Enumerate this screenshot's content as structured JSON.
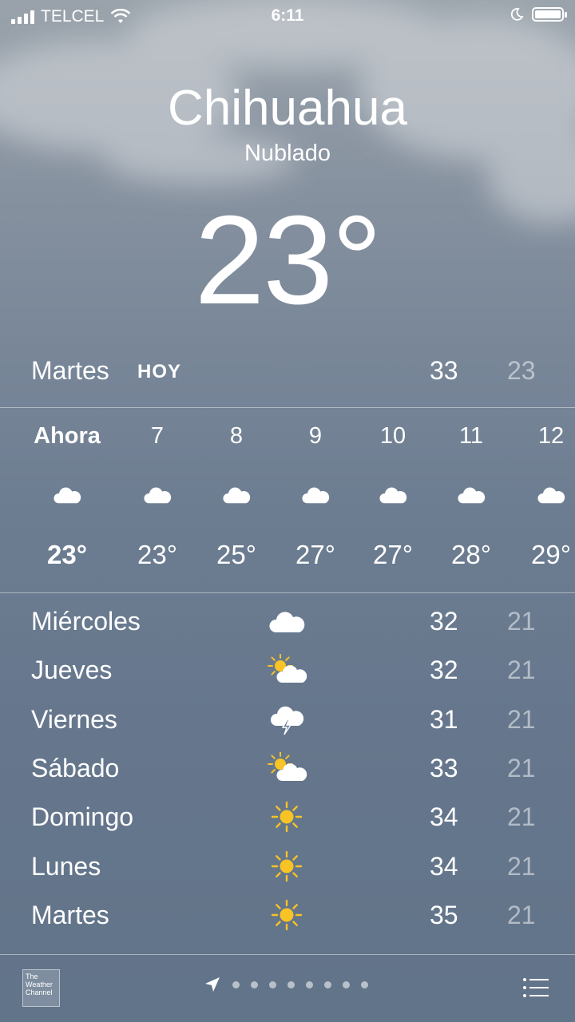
{
  "status_bar": {
    "carrier": "TELCEL",
    "time": "6:11"
  },
  "location": {
    "city": "Chihuahua",
    "condition": "Nublado",
    "temperature": "23°"
  },
  "today": {
    "day": "Martes",
    "tag": "HOY",
    "high": "33",
    "low": "23"
  },
  "hourly": [
    {
      "hour": "Ahora",
      "icon": "cloud-icon",
      "temp": "23°"
    },
    {
      "hour": "7",
      "icon": "cloud-icon",
      "temp": "23°"
    },
    {
      "hour": "8",
      "icon": "cloud-icon",
      "temp": "25°"
    },
    {
      "hour": "9",
      "icon": "cloud-icon",
      "temp": "27°"
    },
    {
      "hour": "10",
      "icon": "cloud-icon",
      "temp": "27°"
    },
    {
      "hour": "11",
      "icon": "cloud-icon",
      "temp": "28°"
    },
    {
      "hour": "12",
      "icon": "cloud-icon",
      "temp": "29°"
    }
  ],
  "daily": [
    {
      "day": "Miércoles",
      "icon": "cloud-icon",
      "high": "32",
      "low": "21"
    },
    {
      "day": "Jueves",
      "icon": "partly-sunny-icon",
      "high": "32",
      "low": "21"
    },
    {
      "day": "Viernes",
      "icon": "thunderstorm-icon",
      "high": "31",
      "low": "21"
    },
    {
      "day": "Sábado",
      "icon": "partly-sunny-icon",
      "high": "33",
      "low": "21"
    },
    {
      "day": "Domingo",
      "icon": "sun-icon",
      "high": "34",
      "low": "21"
    },
    {
      "day": "Lunes",
      "icon": "sun-icon",
      "high": "34",
      "low": "21"
    },
    {
      "day": "Martes",
      "icon": "sun-icon",
      "high": "35",
      "low": "21"
    }
  ],
  "footer": {
    "logo_text": [
      "The",
      "Weather",
      "Channel"
    ]
  },
  "colors": {
    "sun": "#f7c325",
    "secondary_text": "rgba(255,255,255,0.5)"
  }
}
